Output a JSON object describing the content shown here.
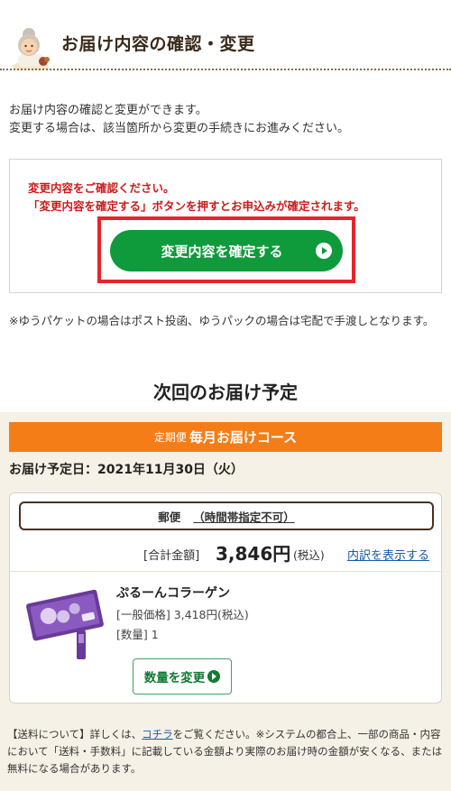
{
  "header": {
    "title": "お届け内容の確認・変更"
  },
  "intro": {
    "line1": "お届け内容の確認と変更ができます。",
    "line2": "変更する場合は、該当箇所から変更の手続きにお進みください。"
  },
  "confirm": {
    "notice1": "変更内容をご確認ください。",
    "notice2": "「変更内容を確定する」ボタンを押すとお申込みが確定されます。",
    "button_label": "変更内容を確定する"
  },
  "delivery_note": "※ゆうパケットの場合はポスト投函、ゆうパックの場合は宅配で手渡しとなります。",
  "next_delivery": {
    "section_title": "次回のお届け予定",
    "course_prefix": "定期便",
    "course_name": "毎月お届けコース",
    "date_label": "お届け予定日：2021年11月30日（火）",
    "shipping_method": "郵便",
    "time_restriction": "（時間帯指定不可）",
    "total_label": "[合計金額]",
    "total_amount": "3,846円",
    "tax_note": "(税込)",
    "breakdown_link": "内訳を表示する",
    "product": {
      "name": "ぷるーんコラーゲン",
      "price_line": "[一般価格] 3,418円(税込)",
      "qty_line": "[数量] 1",
      "change_qty_label": "数量を変更"
    }
  },
  "footnote": {
    "before_link": "【送料について】詳しくは、",
    "link_text": "コチラ",
    "after_link": "をご覧ください。※システムの都合上、一部の商品・内容において「送料・手数料」に記載している金額より実際のお届け時の金額が安くなる、または無料になる場合があります。"
  },
  "colors": {
    "green": "#0f9a3c",
    "orange": "#f57d18",
    "red": "#e8232a",
    "beige": "#f6f1e6"
  }
}
